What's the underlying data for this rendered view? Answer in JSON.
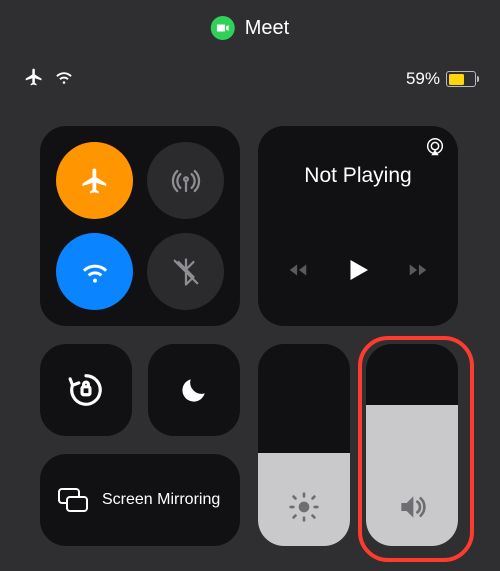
{
  "status_pill": {
    "app_name": "Meet"
  },
  "status_bar": {
    "airplane_on": true,
    "wifi_on": true,
    "battery_percent_text": "59%",
    "battery_level": 59,
    "low_power_mode": true
  },
  "connectivity": {
    "airplane_mode": {
      "active": true,
      "color": "#ff9500"
    },
    "cellular": {
      "active": false
    },
    "wifi": {
      "active": true,
      "color": "#0a84ff"
    },
    "bluetooth": {
      "active": false
    }
  },
  "media": {
    "status_text": "Not Playing",
    "controls": {
      "back": true,
      "play": true,
      "forward": true
    },
    "airplay_visible": true
  },
  "toggles": {
    "rotation_lock": {
      "active": false
    },
    "do_not_disturb": {
      "active": false
    }
  },
  "screen_mirroring": {
    "label": "Screen Mirroring"
  },
  "sliders": {
    "brightness": {
      "value_percent": 46
    },
    "volume": {
      "value_percent": 70,
      "highlighted": true
    }
  },
  "highlight_box": {
    "target": "volume-slider"
  }
}
